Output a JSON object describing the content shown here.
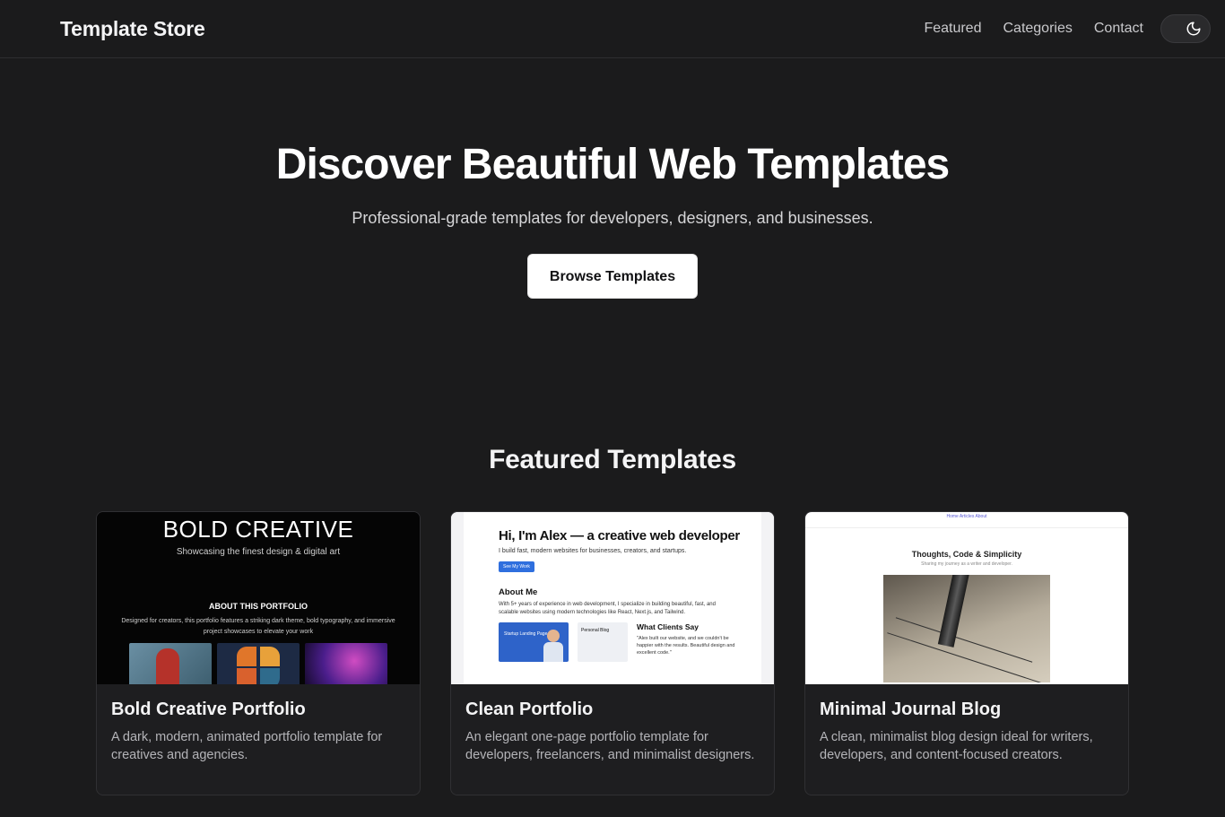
{
  "header": {
    "brand": "Template Store",
    "nav": [
      "Featured",
      "Categories",
      "Contact"
    ],
    "theme_toggle_icon": "moon-icon"
  },
  "hero": {
    "title": "Discover Beautiful Web Templates",
    "subtitle": "Professional-grade templates for developers, designers, and businesses.",
    "cta": "Browse Templates"
  },
  "featured": {
    "title": "Featured Templates",
    "cards": [
      {
        "title": "Bold Creative Portfolio",
        "description": "A dark, modern, animated portfolio template for creatives and agencies.",
        "preview": {
          "heading": "BOLD CREATIVE",
          "tagline": "Showcasing the finest design & digital art",
          "section": "ABOUT THIS PORTFOLIO",
          "text": "Designed for creators, this portfolio features a striking dark theme, bold typography, and immersive project showcases to elevate your work"
        }
      },
      {
        "title": "Clean Portfolio",
        "description": "An elegant one-page portfolio template for developers, freelancers, and minimalist designers.",
        "preview": {
          "heading": "Hi, I'm Alex — a creative web developer",
          "tagline": "I build fast, modern websites for businesses, creators, and startups.",
          "button": "See My Work",
          "section": "About Me",
          "text": "With 5+ years of experience in web development, I specialize in building beautiful, fast, and scalable websites using modern technologies like React, Next.js, and Tailwind.",
          "tile1": "Startup Landing Page",
          "tile2": "Personal Blog",
          "clients_title": "What Clients Say",
          "quote": "\"Alex built our website, and we couldn't be happier with the results. Beautiful design and excellent code.\""
        }
      },
      {
        "title": "Minimal Journal Blog",
        "description": "A clean, minimalist blog design ideal for writers, developers, and content-focused creators.",
        "preview": {
          "nav": "Home   Articles   About",
          "heading": "Thoughts, Code & Simplicity",
          "tagline": "Sharing my journey as a writer and developer."
        }
      }
    ]
  }
}
